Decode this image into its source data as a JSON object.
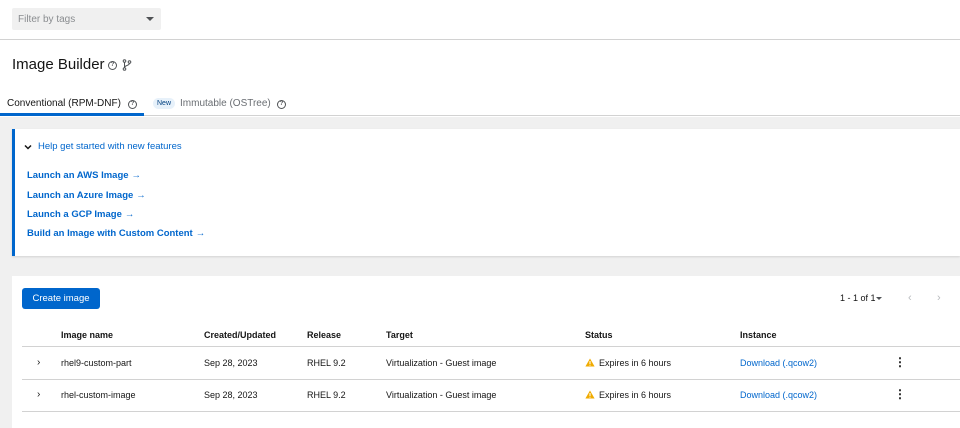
{
  "filter": {
    "placeholder": "Filter by tags"
  },
  "header": {
    "title": "Image Builder"
  },
  "tabs": [
    {
      "label": "Conventional (RPM-DNF)",
      "active": true
    },
    {
      "label": "Immutable (OSTree)",
      "badge": "New",
      "active": false
    }
  ],
  "help_card": {
    "toggle_label": "Help get started with new features",
    "links": [
      {
        "label": "Launch an AWS Image",
        "arrow": "→"
      },
      {
        "label": "Launch an Azure Image",
        "arrow": "→"
      },
      {
        "label": "Launch a GCP Image",
        "arrow": "→"
      },
      {
        "label": "Build an Image with Custom Content",
        "arrow": "→"
      }
    ]
  },
  "toolbar": {
    "create_label": "Create image",
    "pagination_text": "1 - 1 of 1",
    "prev_glyph": "‹",
    "next_glyph": "›"
  },
  "table": {
    "columns": [
      "Image name",
      "Created/Updated",
      "Release",
      "Target",
      "Status",
      "Instance"
    ],
    "rows": [
      {
        "name": "rhel9-custom-part",
        "created": "Sep 28, 2023",
        "release": "RHEL 9.2",
        "target": "Virtualization - Guest image",
        "status": "Expires in 6 hours",
        "instance": "Download (.qcow2)"
      },
      {
        "name": "rhel-custom-image",
        "created": "Sep 28, 2023",
        "release": "RHEL 9.2",
        "target": "Virtualization - Guest image",
        "status": "Expires in 6 hours",
        "instance": "Download (.qcow2)"
      }
    ]
  },
  "colors": {
    "accent": "#0066cc",
    "warning": "#f0ab00",
    "backdrop": "#f0f0f0"
  },
  "icons": [
    "caret-down-icon",
    "help-icon",
    "branch-icon",
    "chevron-down-icon",
    "arrow-right-icon",
    "chevron-right-icon",
    "warning-icon",
    "kebab-icon"
  ]
}
